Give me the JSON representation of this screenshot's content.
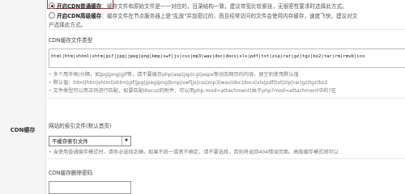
{
  "section_label": "CDN缓存",
  "options": [
    {
      "title": "开启CDN普通缓存",
      "desc": "：缓存文件和原始文件是一一对应的，目录结构一致，建议带宽比较紧张，无很密性要求时选择此方式。",
      "checked": true
    },
    {
      "title": "开启CDN高级缓存",
      "desc": "：缓存文件在节点服务器上是\"乱放\"并加密过的，而且经常访问的文件会使用内存缓存，速度飞快，建议对文",
      "checked": false
    }
  ],
  "option2_continued": "户选择此方式。",
  "file_types": {
    "label": "CDN缓存文件类型",
    "value": "html|htm|shtml|shtm|gif|jpg|jpeg|png|bmp|swf|js|css|mp3|wav|doc|docx|xls|pdf|txt|zip|rar|gz|tgz|bz2|tar|rm|rmvb|ico",
    "notes": [
      "多个用半角|分隔，如jpg|png|gif等，请不要缓存php|asp|jsp|cgi|aspx等动态网页的内容，留空则使用默认值",
      "默认值：html|htm|shtml|shtm|gif|jpg|jpeg|png|bmp|swf|js|css|mp3|wav|doc|docx|xls|pdf|txt|zip|rar|gz|tgz|bz2",
      "文件类型可以用正则进行匹配，如要匹配discuz的附件，可以用php.mod=attachment(由于php?mod=attachment中的?在"
    ]
  },
  "index_file": {
    "label": "网站的索引文件(默认首页)",
    "selected": "不缓存索引文件",
    "note": "当使用普通缓存模式时，请务必选择正确，如果不统一或者不确定，请不要选择，否则将返回404错误页面。高级缓存模式则可以"
  },
  "delete_password": {
    "label": "CDN缓存删除密码",
    "value": ""
  }
}
